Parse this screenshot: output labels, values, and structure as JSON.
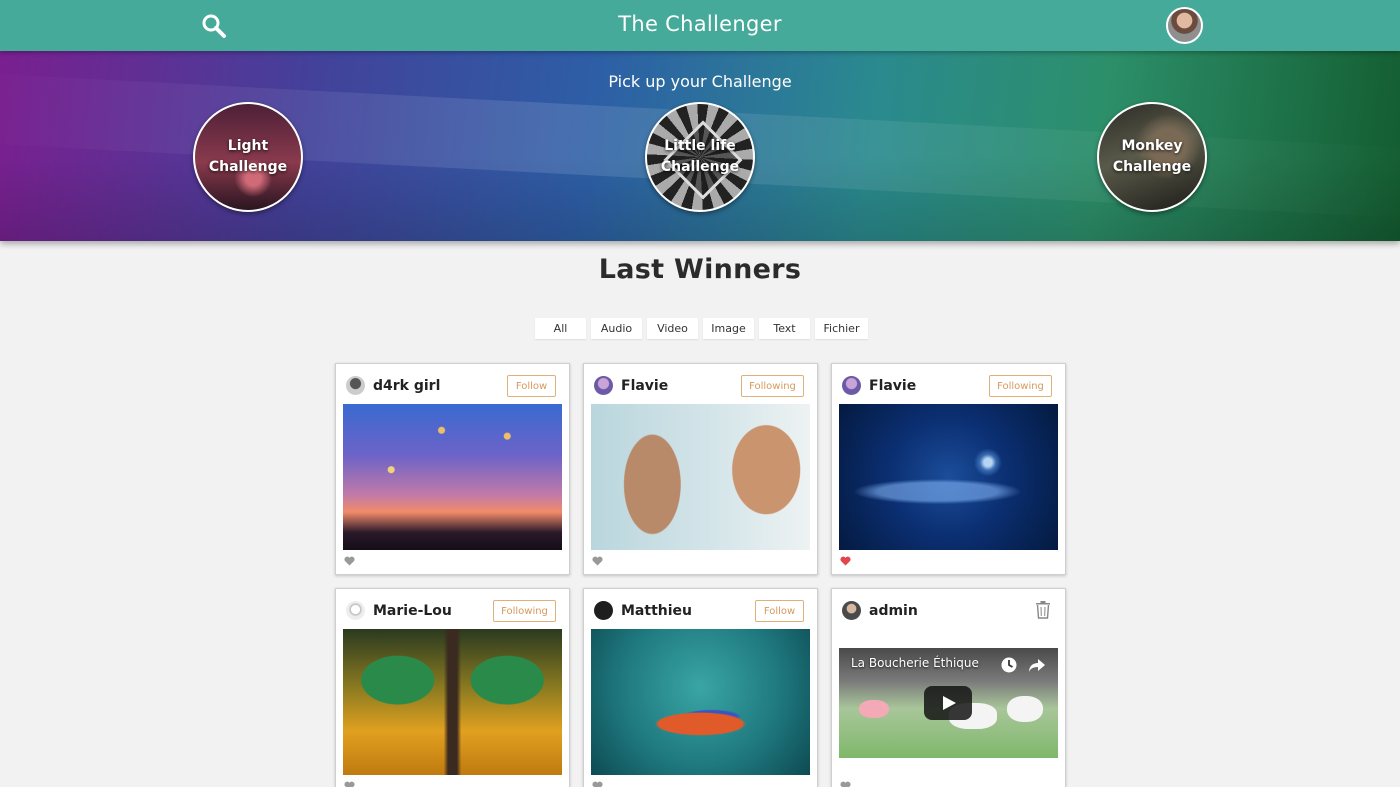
{
  "header": {
    "title": "The Challenger",
    "search_icon": "search-icon",
    "avatar_icon": "user-avatar"
  },
  "hero": {
    "tagline": "Pick up your Challenge",
    "challenges": [
      {
        "label": "Light Challenge"
      },
      {
        "label": "Little life Challenge"
      },
      {
        "label": "Monkey Challenge"
      }
    ]
  },
  "main": {
    "heading": "Last Winners",
    "filters": [
      "All",
      "Audio",
      "Video",
      "Image",
      "Text",
      "Fichier"
    ]
  },
  "cards": [
    {
      "user": "d4rk girl",
      "action": "Follow",
      "liked": false,
      "media": "photo"
    },
    {
      "user": "Flavie",
      "action": "Following",
      "liked": false,
      "media": "photo"
    },
    {
      "user": "Flavie",
      "action": "Following",
      "liked": true,
      "media": "photo"
    },
    {
      "user": "Marie-Lou",
      "action": "Following",
      "liked": false,
      "media": "photo"
    },
    {
      "user": "Matthieu",
      "action": "Follow",
      "liked": false,
      "media": "photo"
    },
    {
      "user": "admin",
      "action": "",
      "liked": false,
      "media": "video",
      "video_title": "La Boucherie Éthique"
    }
  ],
  "colors": {
    "accent": "#45aa9a",
    "follow_border": "#e0b07a",
    "heart_liked": "#e0474c",
    "heart_default": "#999999"
  }
}
